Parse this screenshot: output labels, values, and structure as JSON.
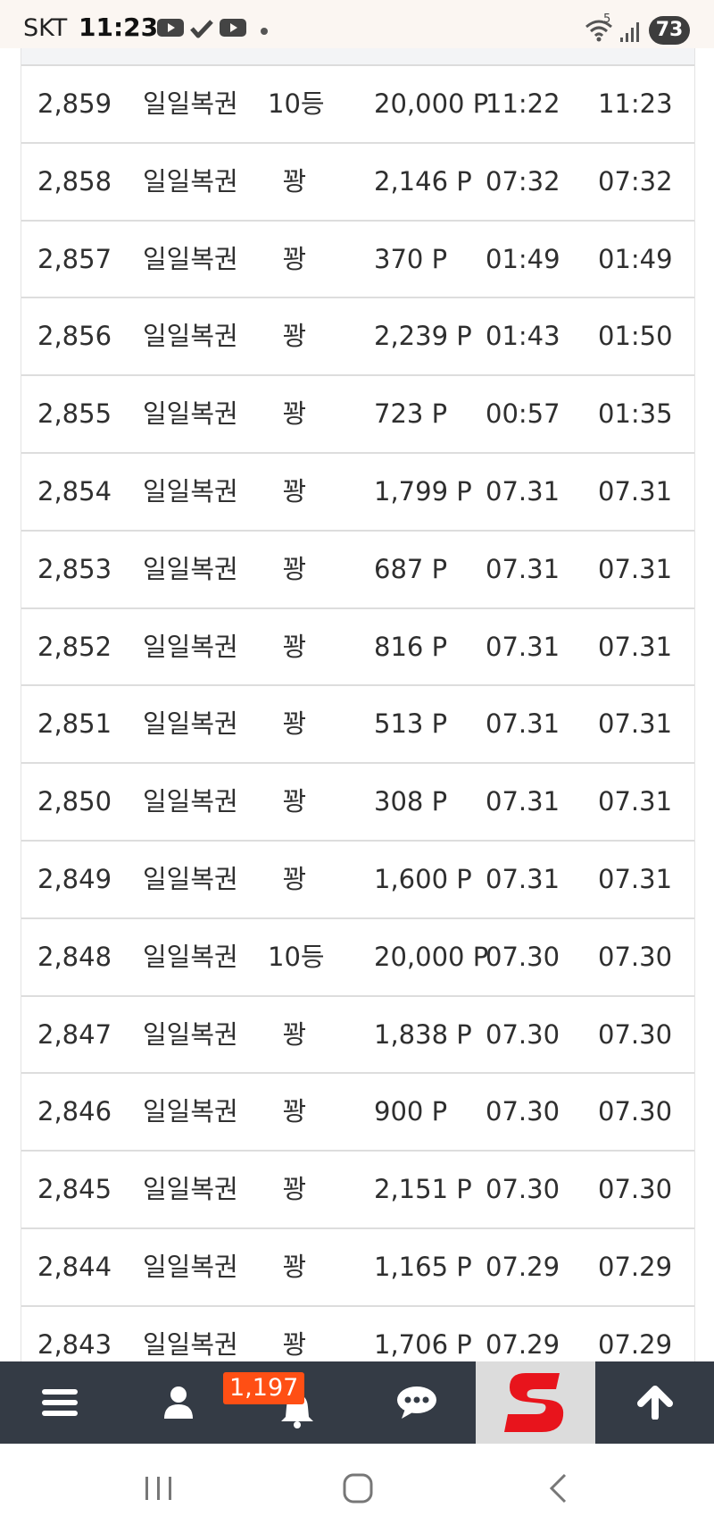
{
  "status_bar": {
    "carrier": "SKT",
    "time": "11:23",
    "battery": "73",
    "wifi_label": "5",
    "notification_icons": [
      "youtube-icon",
      "check-icon",
      "youtube-icon",
      "dot-icon"
    ]
  },
  "table": {
    "rows": [
      {
        "num": "2,859",
        "name": "일일복권",
        "rank": "10등",
        "points": "20,000 P",
        "start": "11:22",
        "end": "11:23"
      },
      {
        "num": "2,858",
        "name": "일일복권",
        "rank": "꽝",
        "points": "2,146 P",
        "start": "07:32",
        "end": "07:32"
      },
      {
        "num": "2,857",
        "name": "일일복권",
        "rank": "꽝",
        "points": "370 P",
        "start": "01:49",
        "end": "01:49"
      },
      {
        "num": "2,856",
        "name": "일일복권",
        "rank": "꽝",
        "points": "2,239 P",
        "start": "01:43",
        "end": "01:50"
      },
      {
        "num": "2,855",
        "name": "일일복권",
        "rank": "꽝",
        "points": "723 P",
        "start": "00:57",
        "end": "01:35"
      },
      {
        "num": "2,854",
        "name": "일일복권",
        "rank": "꽝",
        "points": "1,799 P",
        "start": "07.31",
        "end": "07.31"
      },
      {
        "num": "2,853",
        "name": "일일복권",
        "rank": "꽝",
        "points": "687 P",
        "start": "07.31",
        "end": "07.31"
      },
      {
        "num": "2,852",
        "name": "일일복권",
        "rank": "꽝",
        "points": "816 P",
        "start": "07.31",
        "end": "07.31"
      },
      {
        "num": "2,851",
        "name": "일일복권",
        "rank": "꽝",
        "points": "513 P",
        "start": "07.31",
        "end": "07.31"
      },
      {
        "num": "2,850",
        "name": "일일복권",
        "rank": "꽝",
        "points": "308 P",
        "start": "07.31",
        "end": "07.31"
      },
      {
        "num": "2,849",
        "name": "일일복권",
        "rank": "꽝",
        "points": "1,600 P",
        "start": "07.31",
        "end": "07.31"
      },
      {
        "num": "2,848",
        "name": "일일복권",
        "rank": "10등",
        "points": "20,000 P",
        "start": "07.30",
        "end": "07.30"
      },
      {
        "num": "2,847",
        "name": "일일복권",
        "rank": "꽝",
        "points": "1,838 P",
        "start": "07.30",
        "end": "07.30"
      },
      {
        "num": "2,846",
        "name": "일일복권",
        "rank": "꽝",
        "points": "900 P",
        "start": "07.30",
        "end": "07.30"
      },
      {
        "num": "2,845",
        "name": "일일복권",
        "rank": "꽝",
        "points": "2,151 P",
        "start": "07.30",
        "end": "07.30"
      },
      {
        "num": "2,844",
        "name": "일일복권",
        "rank": "꽝",
        "points": "1,165 P",
        "start": "07.29",
        "end": "07.29"
      },
      {
        "num": "2,843",
        "name": "일일복권",
        "rank": "꽝",
        "points": "1,706 P",
        "start": "07.29",
        "end": "07.29"
      }
    ]
  },
  "toolbar": {
    "items": [
      "menu-icon",
      "user-icon",
      "bell-icon",
      "chat-icon",
      "site-logo",
      "arrow-up-icon"
    ],
    "notification_count": "1,197",
    "badge_color": "#ff4f14",
    "background": "#343b45",
    "logo_color": "#e8141c"
  },
  "navbar": {
    "items": [
      "recent-apps-icon",
      "home-icon",
      "back-icon"
    ]
  }
}
